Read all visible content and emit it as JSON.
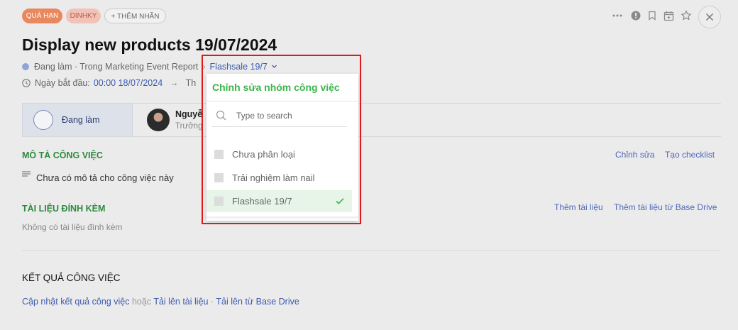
{
  "tags": {
    "overdue": "QUÁ HẠN",
    "dinhky": "DINHKY",
    "add_tag": "+ THÊM NHÃN"
  },
  "toolbar_icons": [
    "more-icon",
    "alert-icon",
    "bookmark-icon",
    "calendar-icon",
    "star-icon",
    "close-icon"
  ],
  "task": {
    "title": "Display new products 19/07/2024",
    "status_line": "Đang làm · Trong Marketing Event Report",
    "separator": "›",
    "group_link": "Flashsale 19/7",
    "start_label": "Ngày bắt đầu:",
    "start_value": "00:00 18/07/2024",
    "arrow": "→",
    "end_partial": "Th"
  },
  "status": {
    "label": "Đang làm"
  },
  "assignee": {
    "name": "Nguyễn",
    "role": "Trưởng"
  },
  "description": {
    "title": "MÔ TẢ CÔNG VIỆC",
    "edit": "Chỉnh sửa",
    "checklist": "Tạo checklist",
    "empty": "Chưa có mô tả cho công việc này"
  },
  "attachments": {
    "title": "TÀI LIỆU ĐÍNH KÈM",
    "add": "Thêm tài liệu",
    "add_from_drive": "Thêm tài liệu từ Base Drive",
    "empty": "Không có tài liệu đính kèm"
  },
  "results": {
    "title": "KẾT QUẢ CÔNG VIỆC",
    "update": "Cập nhật kết quả công việc",
    "or": "hoặc",
    "upload": "Tải lên tài liệu",
    "dot": "·",
    "upload_drive": "Tải lên từ Base Drive"
  },
  "dropdown": {
    "title": "Chỉnh sửa nhóm công việc",
    "search_placeholder": "Type to search",
    "items": [
      {
        "label": "Chưa phân loại",
        "selected": false
      },
      {
        "label": "Trải nghiệm làm nail",
        "selected": false
      },
      {
        "label": "Flashsale 19/7",
        "selected": true
      }
    ]
  },
  "colors": {
    "overdue_tag": "#e9885c",
    "accent_green": "#3bb54a",
    "link_blue": "#3c5bb0",
    "highlight_red": "#e01a1a"
  }
}
